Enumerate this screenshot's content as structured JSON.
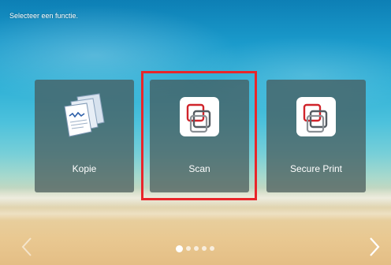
{
  "header": {
    "instruction": "Selecteer een functie."
  },
  "tiles": [
    {
      "label": "Kopie",
      "icon": "copy-documents-icon"
    },
    {
      "label": "Scan",
      "icon": "scan-icon",
      "highlighted": true
    },
    {
      "label": "Secure Print",
      "icon": "secure-print-icon"
    }
  ],
  "pager": {
    "page_count": 5,
    "current_page": 1
  },
  "navigation": {
    "left_icon": "chevron-left-icon",
    "right_icon": "chevron-right-icon"
  },
  "colors": {
    "highlight": "#e8262a",
    "tile_background": "#465858"
  }
}
